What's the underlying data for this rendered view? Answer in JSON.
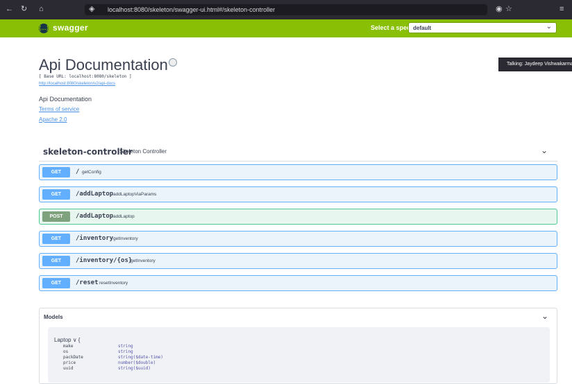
{
  "browser": {
    "url": "localhost:8080/skeleton/swagger-ui.html#/skeleton-controller"
  },
  "topbar": {
    "logo_text": "swagger",
    "spec_label": "Select a spec",
    "spec_value": "default"
  },
  "info": {
    "title": "Api Documentation",
    "base_url": "[ Base URL: localhost:8080/skeleton ]",
    "docs_link": "http://localhost:8080/skeleton/v2/api-docs",
    "description": "Api Documentation",
    "terms": "Terms of service",
    "license": "Apache 2.0"
  },
  "toast": {
    "text": "Talking: Jaydeep Vishwakarma"
  },
  "controller": {
    "name": "skeleton-controller",
    "description": "Skeleton Controller"
  },
  "operations": [
    {
      "method": "GET",
      "path": "/",
      "summary": "getConfig"
    },
    {
      "method": "GET",
      "path": "/addLaptop",
      "summary": "addLaptopViaParams"
    },
    {
      "method": "POST",
      "path": "/addLaptop",
      "summary": "addLaptop"
    },
    {
      "method": "GET",
      "path": "/inventory",
      "summary": "getInventory"
    },
    {
      "method": "GET",
      "path": "/inventory/{os}",
      "summary": "getInventory"
    },
    {
      "method": "GET",
      "path": "/reset",
      "summary": "resetInventory"
    }
  ],
  "models": {
    "title": "Models",
    "model_name": "Laptop",
    "model_expander": "∨ {",
    "properties": [
      {
        "name": "make",
        "type": "string"
      },
      {
        "name": "os",
        "type": "string"
      },
      {
        "name": "packDate",
        "type": "string($date-time)"
      },
      {
        "name": "price",
        "type": "number($double)"
      },
      {
        "name": "uuid",
        "type": "string($uuid)"
      }
    ]
  },
  "colors": {
    "topbar": "#89bf04",
    "get": "#61affe",
    "post": "#49cc90"
  }
}
